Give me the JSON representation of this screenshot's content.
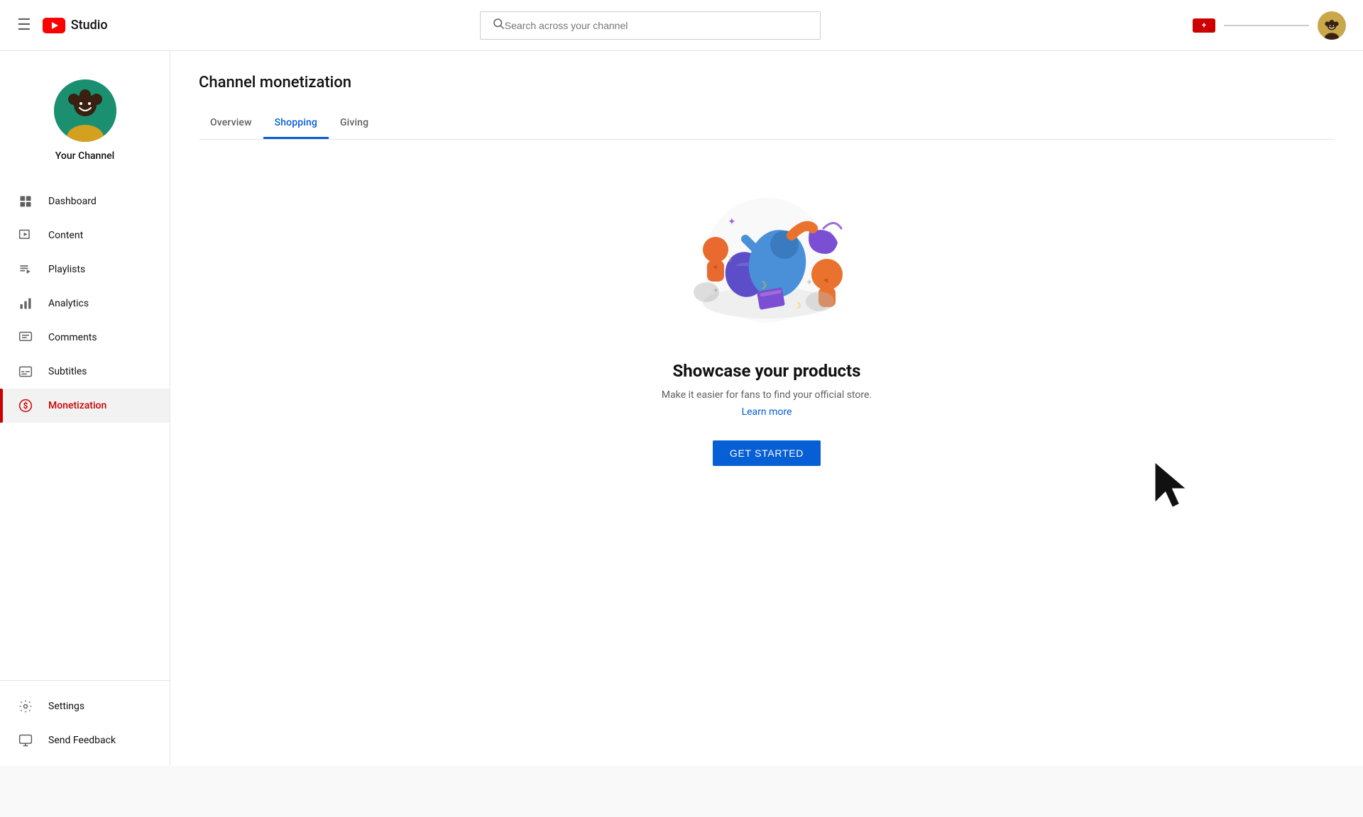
{
  "topbar": {
    "menu_icon": "☰",
    "logo_text": "Studio",
    "search_placeholder": "Search across your channel",
    "user_avatar_alt": "User avatar"
  },
  "sidebar": {
    "channel_name": "Your Channel",
    "nav_items": [
      {
        "id": "dashboard",
        "label": "Dashboard",
        "icon": "dashboard"
      },
      {
        "id": "content",
        "label": "Content",
        "icon": "content"
      },
      {
        "id": "playlists",
        "label": "Playlists",
        "icon": "playlists"
      },
      {
        "id": "analytics",
        "label": "Analytics",
        "icon": "analytics"
      },
      {
        "id": "comments",
        "label": "Comments",
        "icon": "comments"
      },
      {
        "id": "subtitles",
        "label": "Subtitles",
        "icon": "subtitles"
      },
      {
        "id": "monetization",
        "label": "Monetization",
        "icon": "monetization",
        "active": true
      }
    ],
    "bottom_items": [
      {
        "id": "settings",
        "label": "Settings",
        "icon": "settings"
      },
      {
        "id": "send-feedback",
        "label": "Send Feedback",
        "icon": "feedback"
      }
    ]
  },
  "main": {
    "page_title": "Channel monetization",
    "tabs": [
      {
        "id": "overview",
        "label": "Overview",
        "active": false
      },
      {
        "id": "shopping",
        "label": "Shopping",
        "active": true
      },
      {
        "id": "giving",
        "label": "Giving",
        "active": false
      }
    ],
    "shopping": {
      "title": "Showcase your products",
      "description": "Make it easier for fans to find your official store.",
      "learn_more": "Learn more",
      "get_started": "GET STARTED"
    }
  }
}
